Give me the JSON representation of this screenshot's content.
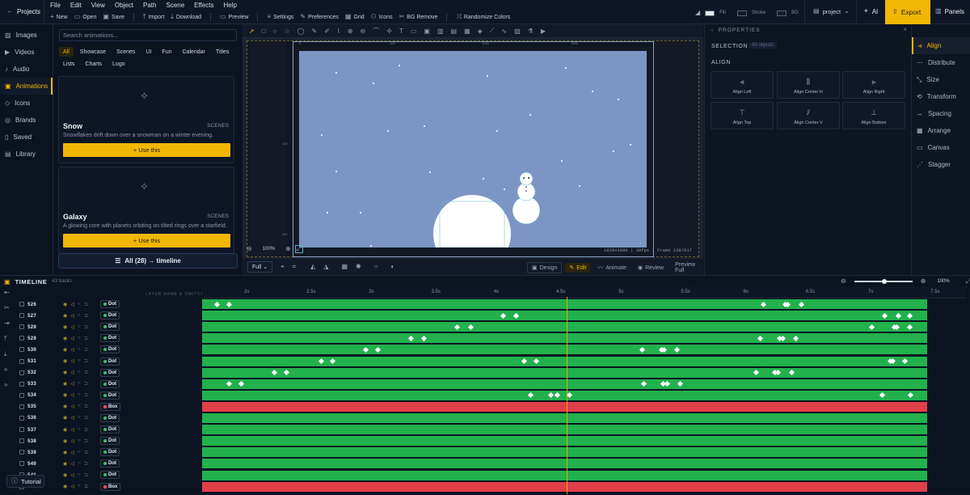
{
  "topbar": {
    "projects_label": "Projects",
    "menu": [
      "File",
      "Edit",
      "View",
      "Object",
      "Path",
      "Scene",
      "Effects",
      "Help"
    ],
    "toolbar": [
      "New",
      "Open",
      "Save",
      "Import",
      "Download",
      "Preview",
      "Settings",
      "Preferences",
      "Grid",
      "Icons",
      "BG Remove",
      "Randomize Colors"
    ],
    "fill_label": "Fill",
    "stroke_label": "Stroke",
    "bg_label": "BG",
    "project_label": "project",
    "ai_label": "AI",
    "export_label": "Export",
    "panels_label": "Panels"
  },
  "leftnav": {
    "items": [
      "Images",
      "Videos",
      "Audio",
      "Animations",
      "Icons",
      "Brands",
      "Saved",
      "Library"
    ],
    "active": "Animations"
  },
  "library": {
    "search_placeholder": "Search animations...",
    "filters": [
      "All",
      "Showcase",
      "Scenes",
      "UI",
      "Fun",
      "Calendar",
      "Titles",
      "Lists",
      "Charts",
      "Logo"
    ],
    "active_filter": "All",
    "cards": [
      {
        "title": "Snow",
        "tag": "SCENES",
        "desc": "Snowflakes drift down over a snowman on a winter evening.",
        "button": "Use this"
      },
      {
        "title": "Galaxy",
        "tag": "SCENES",
        "desc": "A glowing core with planets orbiting on tilted rings over a starfield.",
        "button": "Use this"
      }
    ],
    "all_button": "All (28) → timeline"
  },
  "canvas": {
    "zoom": "100%",
    "info": "1920x1080 | 30fps | Frame 138/617",
    "ruler_top": [
      "0",
      "100",
      "1000",
      "1500"
    ],
    "ruler_left": [
      "100",
      "800"
    ],
    "view_select": "Full",
    "modes": [
      "Design",
      "Edit",
      "Animate",
      "Review"
    ],
    "active_mode": "Edit",
    "preview_full": "Preview Full"
  },
  "properties": {
    "header": "PROPERTIES",
    "selection_label": "SELECTION",
    "selection_count": "43 objects",
    "align_label": "ALIGN",
    "buttons": [
      "Align Left",
      "Align Center H",
      "Align Right",
      "Align Top",
      "Align Center V",
      "Align Bottom"
    ]
  },
  "sidetabs": {
    "items": [
      "Align",
      "Distribute",
      "Size",
      "Transform",
      "Spacing",
      "Arrange",
      "Canvas",
      "Stagger"
    ],
    "active": "Align"
  },
  "timeline": {
    "title": "TIMELINE",
    "count": "43 tracks",
    "layer_header": "LAYER NAME & SWITCHES",
    "zoom": "100%",
    "ticks": [
      "2s",
      "2.5s",
      "3s",
      "3.5s",
      "4s",
      "4.5s",
      "5s",
      "5.5s",
      "6s",
      "6.5s",
      "7s",
      "7.5s"
    ],
    "tracks": [
      {
        "id": "526",
        "type": "Dot"
      },
      {
        "id": "527",
        "type": "Dot"
      },
      {
        "id": "528",
        "type": "Dot"
      },
      {
        "id": "529",
        "type": "Dot"
      },
      {
        "id": "530",
        "type": "Dot"
      },
      {
        "id": "531",
        "type": "Dot"
      },
      {
        "id": "532",
        "type": "Dot"
      },
      {
        "id": "533",
        "type": "Dot"
      },
      {
        "id": "534",
        "type": "Dot"
      },
      {
        "id": "535",
        "type": "Box"
      },
      {
        "id": "536",
        "type": "Dot"
      },
      {
        "id": "537",
        "type": "Dot"
      },
      {
        "id": "538",
        "type": "Dot"
      },
      {
        "id": "539",
        "type": "Dot"
      },
      {
        "id": "540",
        "type": "Dot"
      },
      {
        "id": "541",
        "type": "Dot"
      },
      {
        "id": "542",
        "type": "Box"
      }
    ],
    "tutorial_label": "Tutorial",
    "colors": {
      "dot": "#22b14c",
      "box": "#e0404a",
      "accent": "#f2b705"
    }
  }
}
